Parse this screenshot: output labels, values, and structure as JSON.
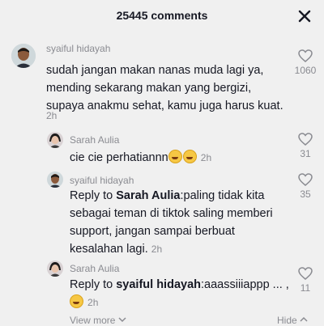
{
  "header": {
    "title": "25445 comments",
    "close_icon": "close-icon"
  },
  "comments": [
    {
      "username": "syaiful hidayah",
      "text": "sudah jangan makan nanas muda lagi ya, mending sekarang makan yang bergizi, supaya anakmu sehat, kamu juga harus kuat.",
      "time": "2h",
      "likes": "1060"
    }
  ],
  "replies": [
    {
      "username": "Sarah Aulia",
      "text": "cie cie perhatiannn",
      "emoji": "rofl-emoji",
      "time": "2h",
      "likes": "31"
    },
    {
      "username": "syaiful hidayah",
      "reply_prefix": "Reply to ",
      "mention": "Sarah Aulia",
      "text": ":paling tidak kita sebagai teman di tiktok saling memberi support, jangan sampai berbuat kesalahan lagi.",
      "time": "2h",
      "likes": "35"
    },
    {
      "username": "Sarah Aulia",
      "reply_prefix": "Reply to ",
      "mention": "syaiful hidayah",
      "text": ":aaassiiiappp ... ,",
      "emoji": "grin-emoji",
      "time": "2h",
      "likes": "11"
    }
  ],
  "footer": {
    "view_more": "View more",
    "hide": "Hide"
  },
  "colors": {
    "background": "#f0f0f0",
    "text": "#161823",
    "muted": "#8a8b91"
  }
}
